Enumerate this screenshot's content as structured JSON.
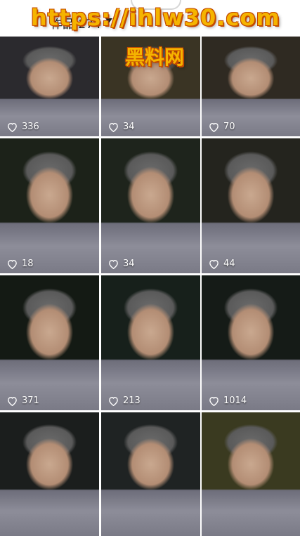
{
  "header": {
    "works_label": "作品 274"
  },
  "watermark": {
    "line1": "https://ihlw30.com",
    "line2": "黑料网"
  },
  "grid": {
    "items": [
      {
        "likes": "336",
        "tone": "#2b2a2e"
      },
      {
        "likes": "34",
        "tone": "#3a3424"
      },
      {
        "likes": "70",
        "tone": "#2f2a22"
      },
      {
        "likes": "18",
        "tone": "#1c2219"
      },
      {
        "likes": "34",
        "tone": "#1e241c"
      },
      {
        "likes": "44",
        "tone": "#24241e"
      },
      {
        "likes": "371",
        "tone": "#141a14"
      },
      {
        "likes": "213",
        "tone": "#17201b"
      },
      {
        "likes": "1014",
        "tone": "#151b17"
      },
      {
        "likes": "",
        "tone": "#1b1e1d"
      },
      {
        "likes": "",
        "tone": "#1f2323"
      },
      {
        "likes": "",
        "tone": "#3a3a20"
      }
    ]
  }
}
